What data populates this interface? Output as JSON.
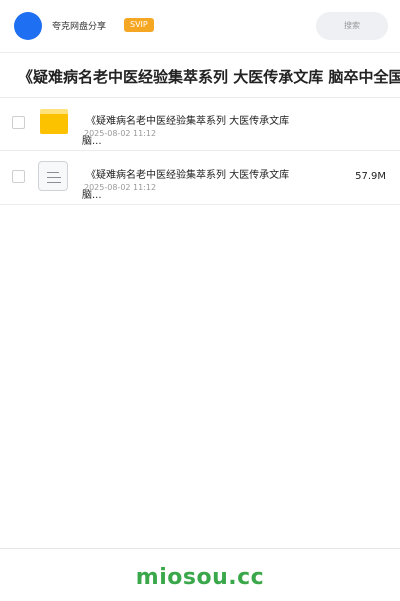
{
  "header": {
    "app_name": "夸克网盘分享",
    "badge": "SVIP",
    "search_placeholder": "搜索",
    "avatar_color": "#1e6ff1",
    "badge_color": "#f5a623"
  },
  "page_title": "《疑难病名老中医经验集萃系列 大医传承文库 脑卒中全国名老中医",
  "files": [
    {
      "icon": "folder-icon",
      "name": "《疑难病名老中医经验集萃系列  大医传承文库",
      "name_wrap": "脑...",
      "date": "2025-08-02 11:12",
      "size": ""
    },
    {
      "icon": "document-icon",
      "name": "《疑难病名老中医经验集萃系列  大医传承文库",
      "name_wrap": "脑...",
      "date": "2025-08-02 11:12",
      "size": "57.9M"
    }
  ],
  "footer": {
    "watermark": "miosou.cc",
    "watermark_color": "#3aa84a"
  }
}
